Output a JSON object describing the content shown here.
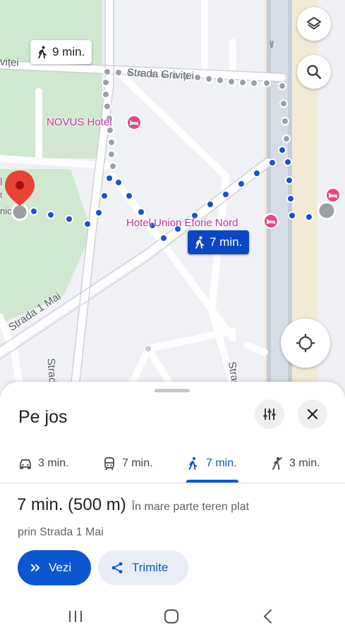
{
  "map": {
    "streets": {
      "grivitei": "Strada Griviței",
      "grivitei_cut": "viței",
      "mai": "Strada 1 Mai",
      "di": "Strada Di",
      "strad": "Strad"
    },
    "pois": {
      "novus": "NOVUS Hotel",
      "union": "Hotel Union Eforie Nord",
      "left_cut_1": "l",
      "left_cut_2": "t",
      "left_cut_3": "nic"
    },
    "chips": {
      "alt_walk": "9 min.",
      "active_walk": "7 min."
    },
    "icons": {
      "layers": "layers-icon",
      "search": "search-icon",
      "locate": "my-location-icon"
    }
  },
  "sheet": {
    "title": "Pe jos",
    "modes": [
      {
        "icon": "car-icon",
        "label": "3 min."
      },
      {
        "icon": "transit-icon",
        "label": "7 min."
      },
      {
        "icon": "walk-icon",
        "label": "7 min."
      },
      {
        "icon": "ride-icon",
        "label": "3 min."
      }
    ],
    "active_mode": 2,
    "route": {
      "time_distance": "7 min. (500 m)",
      "terrain": "În mare parte teren plat",
      "via": "prin Strada 1 Mai"
    },
    "buttons": {
      "view": "Vezi",
      "share": "Trimite"
    }
  },
  "colors": {
    "route_active": "#1a4fd6",
    "route_alt": "#9aa0a6",
    "accent": "#0b57d0",
    "park": "#c8e6c9",
    "beach": "#f5ecd7",
    "hotel_pink": "#e2478b"
  }
}
